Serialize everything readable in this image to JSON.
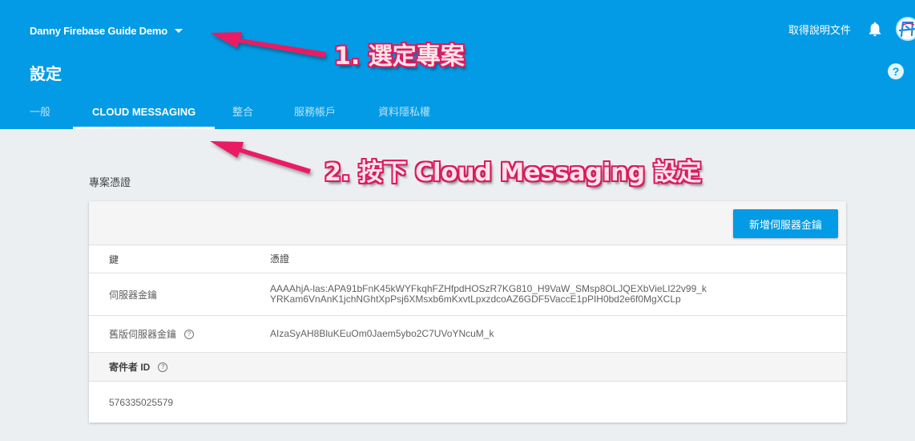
{
  "header": {
    "project_name": "Danny Firebase Guide Demo",
    "page_title": "設定",
    "docs_link": "取得說明文件",
    "avatar_text": "丹",
    "help_symbol": "?",
    "brand_color": "#039be5"
  },
  "tabs": [
    {
      "label": "一般",
      "active": false
    },
    {
      "label": "CLOUD MESSAGING",
      "active": true
    },
    {
      "label": "整合",
      "active": false
    },
    {
      "label": "服務帳戶",
      "active": false
    },
    {
      "label": "資料隱私權",
      "active": false
    }
  ],
  "section": {
    "title": "專案憑證"
  },
  "credentials": {
    "add_button": "新增伺服器金鑰",
    "columns": {
      "key": "鍵",
      "credential": "憑證"
    },
    "server_key": {
      "label": "伺服器金鑰",
      "value_line1": "AAAAhjA-las:APA91bFnK45kWYFkqhFZHfpdHOSzR7KG810_H9VaW_SMsp8OLJQEXbVieLI22v99_k",
      "value_line2": "YRKam6VnAnK1jchNGhtXpPsj6XMsxb6mKxvtLpxzdcoAZ6GDF5VaccE1pPIH0bd2e6f0MgXCLp"
    },
    "legacy_key": {
      "label": "舊版伺服器金鑰",
      "value": "AIzaSyAH8BluKEuOm0Jaem5ybo2C7UVoYNcuM_k"
    },
    "sender": {
      "label": "寄件者 ID",
      "value": "576335025579"
    },
    "info_symbol": "?"
  },
  "annotations": {
    "step1": "1. 選定專案",
    "step2": "2. 按下 Cloud Messaging 設定",
    "arrow_color": "#e91e63"
  }
}
